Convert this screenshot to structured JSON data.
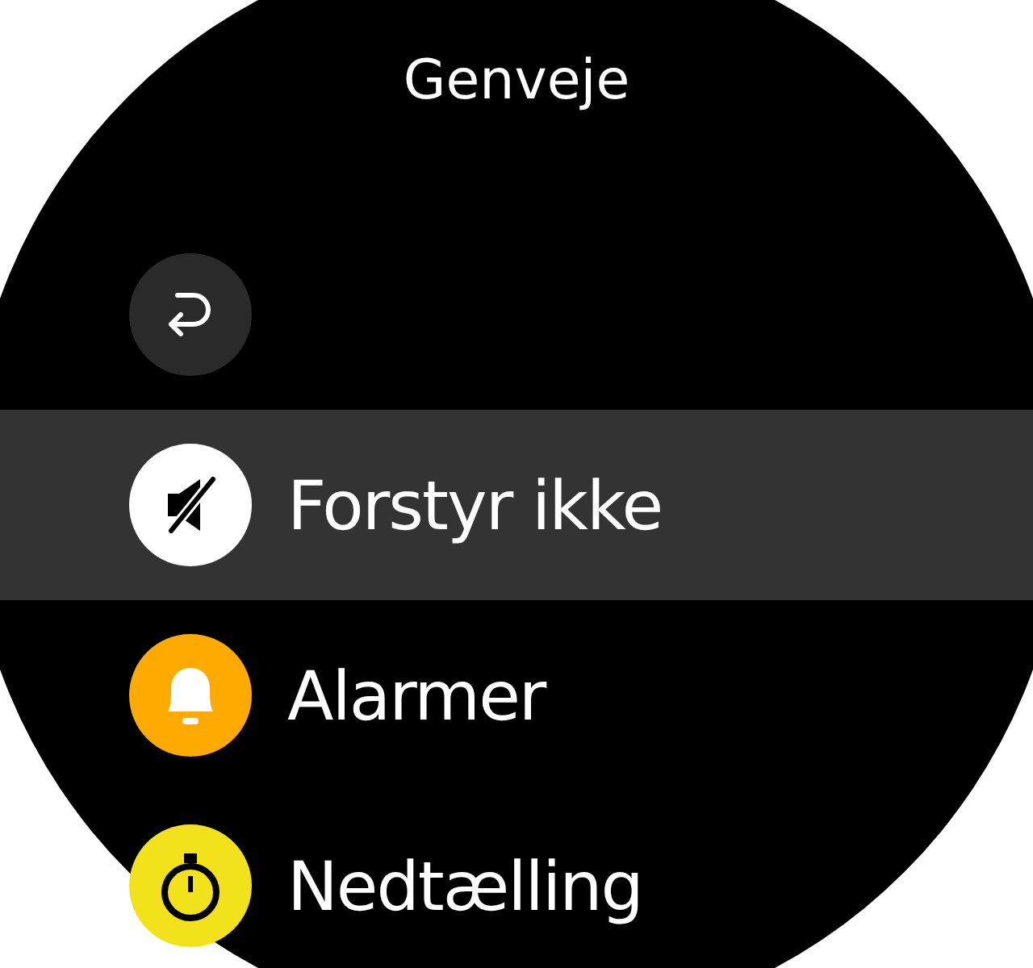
{
  "title": "Genveje",
  "items": [
    {
      "kind": "back",
      "color": "#2a2a2a",
      "selected": false
    },
    {
      "kind": "dnd",
      "label": "Forstyr ikke",
      "color": "#ffffff",
      "selected": true
    },
    {
      "kind": "alarm",
      "label": "Alarmer",
      "color": "#ffaa00",
      "selected": false
    },
    {
      "kind": "timer",
      "label": "Nedtælling",
      "color": "#f2e21c",
      "selected": false
    }
  ]
}
